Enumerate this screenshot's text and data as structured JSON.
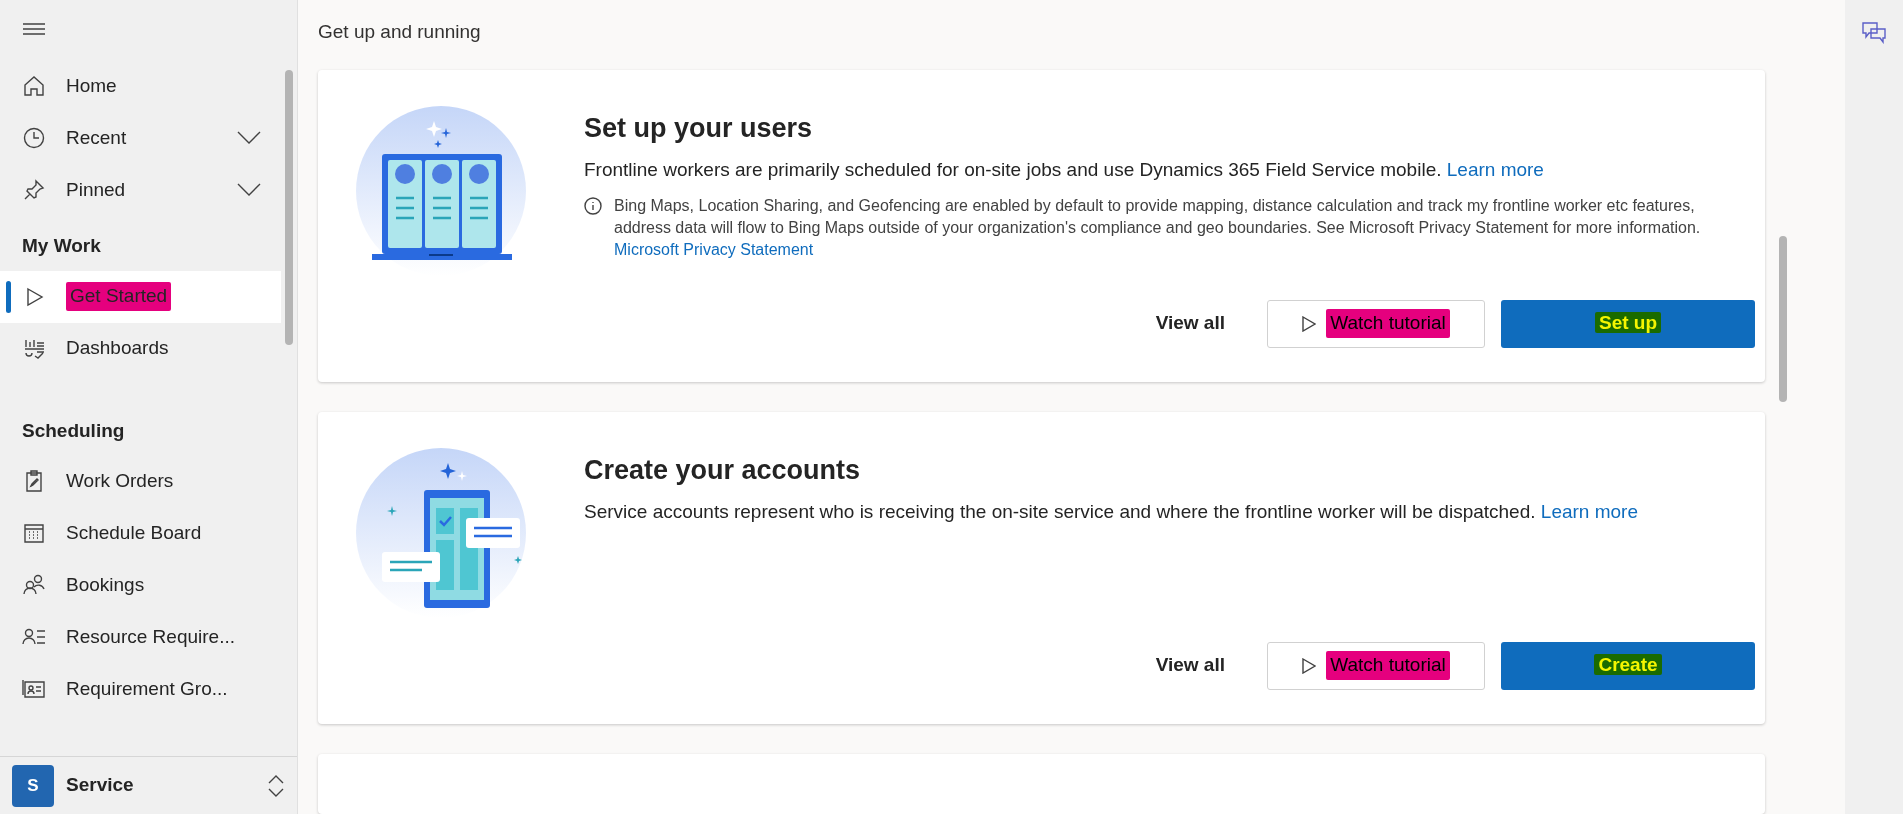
{
  "sidebar": {
    "nav": [
      {
        "label": "Home",
        "expandable": false
      },
      {
        "label": "Recent",
        "expandable": true
      },
      {
        "label": "Pinned",
        "expandable": true
      }
    ],
    "sections": [
      {
        "title": "My Work",
        "items": [
          {
            "label": "Get Started",
            "selected": true,
            "highlighted": true
          },
          {
            "label": "Dashboards",
            "selected": false,
            "highlighted": false
          }
        ]
      },
      {
        "title": "Scheduling",
        "items": [
          {
            "label": "Work Orders",
            "selected": false,
            "highlighted": false
          },
          {
            "label": "Schedule Board",
            "selected": false,
            "highlighted": false
          },
          {
            "label": "Bookings",
            "selected": false,
            "highlighted": false
          },
          {
            "label": "Resource Require...",
            "selected": false,
            "highlighted": false
          },
          {
            "label": "Requirement Gro...",
            "selected": false,
            "highlighted": false
          }
        ]
      }
    ],
    "area": {
      "initial": "S",
      "name": "Service"
    }
  },
  "page_title": "Get up and running",
  "cards": [
    {
      "title": "Set up your users",
      "description": "Frontline workers are primarily scheduled for on-site jobs and use Dynamics 365 Field Service mobile.",
      "link": "Learn more",
      "note": "Bing Maps, Location Sharing, and Geofencing are enabled by default to provide mapping, distance calculation and track my frontline worker etc features, address data will flow to Bing Maps outside of your organization's compliance and geo boundaries. See Microsoft Privacy Statement for more information.",
      "note_link": "Microsoft Privacy Statement",
      "view_all": "View all",
      "tutorial": {
        "label": "Watch tutorial",
        "highlighted": true
      },
      "primary": {
        "label": "Set up",
        "highlighted": true
      }
    },
    {
      "title": "Create your accounts",
      "description": "Service accounts represent who is receiving the on-site service and where the frontline worker will be dispatched.",
      "link": "Learn more",
      "view_all": "View all",
      "tutorial": {
        "label": "Watch tutorial",
        "highlighted": true
      },
      "primary": {
        "label": "Create",
        "highlighted": true
      }
    }
  ]
}
